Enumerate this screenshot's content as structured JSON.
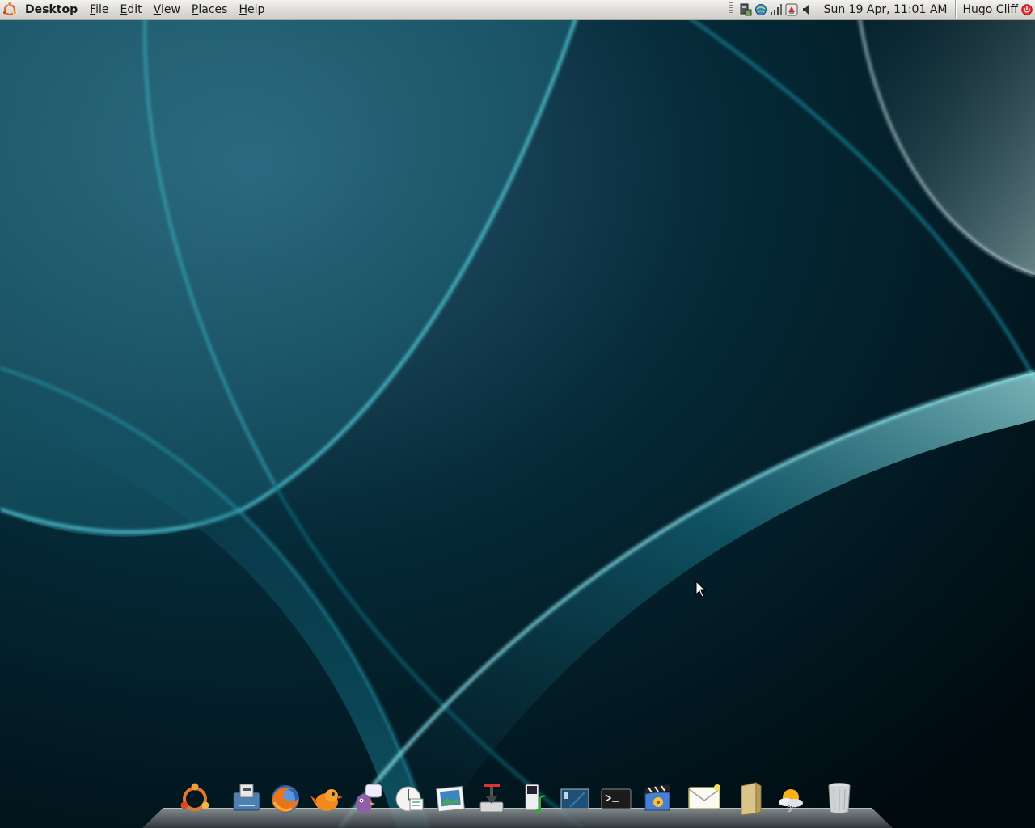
{
  "top_panel": {
    "app_name": "Desktop",
    "menus": [
      {
        "pre": "",
        "key": "F",
        "post": "ile"
      },
      {
        "pre": "",
        "key": "E",
        "post": "dit"
      },
      {
        "pre": "",
        "key": "V",
        "post": "iew"
      },
      {
        "pre": "",
        "key": "P",
        "post": "laces"
      },
      {
        "pre": "",
        "key": "H",
        "post": "elp"
      }
    ],
    "clock": "Sun 19 Apr, 11:01 AM",
    "user": "Hugo Cliff"
  },
  "tray_icons": [
    "system-monitor-icon",
    "network-manager-icon",
    "signal-strength-icon",
    "update-notifier-icon",
    "volume-icon"
  ],
  "dock": {
    "icons": [
      "ubuntu-icon",
      "screenlet-icon",
      "firefox-icon",
      "gwibber-icon",
      "pidgin-icon",
      "email-client-icon",
      "image-viewer-icon",
      "download-manager-icon",
      "music-player-icon",
      "desktop-switcher-icon",
      "terminal-icon",
      "video-player-icon",
      "mail-notification-icon",
      "file-manager-icon",
      "weather-icon",
      "trash-icon"
    ],
    "weather_temp": "9°"
  },
  "colors": {
    "panel_bg": "#dcdad5",
    "wallpaper_dark": "#01141c",
    "wallpaper_cyan": "#2fb6c8"
  }
}
